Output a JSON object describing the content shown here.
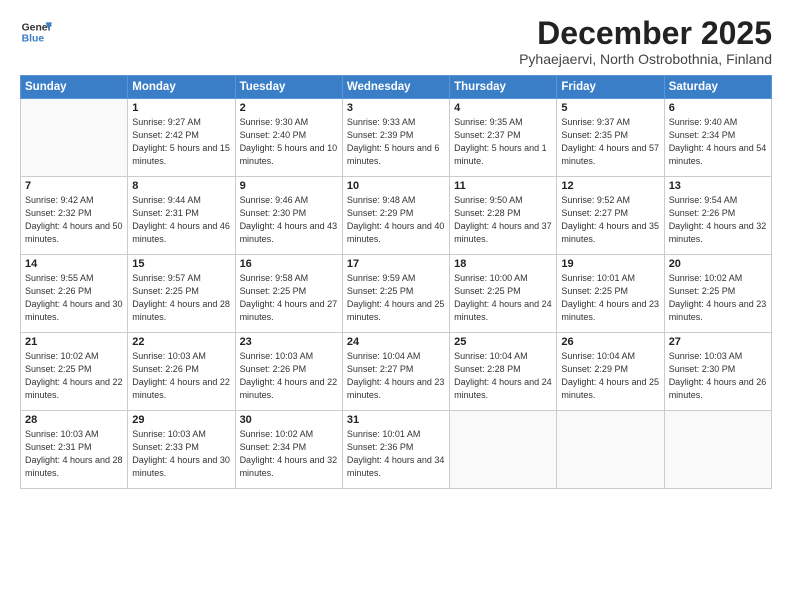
{
  "header": {
    "logo_line1": "General",
    "logo_line2": "Blue",
    "month": "December 2025",
    "location": "Pyhaejaervi, North Ostrobothnia, Finland"
  },
  "days_of_week": [
    "Sunday",
    "Monday",
    "Tuesday",
    "Wednesday",
    "Thursday",
    "Friday",
    "Saturday"
  ],
  "weeks": [
    [
      {
        "day": "",
        "info": ""
      },
      {
        "day": "1",
        "info": "Sunrise: 9:27 AM\nSunset: 2:42 PM\nDaylight: 5 hours\nand 15 minutes."
      },
      {
        "day": "2",
        "info": "Sunrise: 9:30 AM\nSunset: 2:40 PM\nDaylight: 5 hours\nand 10 minutes."
      },
      {
        "day": "3",
        "info": "Sunrise: 9:33 AM\nSunset: 2:39 PM\nDaylight: 5 hours\nand 6 minutes."
      },
      {
        "day": "4",
        "info": "Sunrise: 9:35 AM\nSunset: 2:37 PM\nDaylight: 5 hours\nand 1 minute."
      },
      {
        "day": "5",
        "info": "Sunrise: 9:37 AM\nSunset: 2:35 PM\nDaylight: 4 hours\nand 57 minutes."
      },
      {
        "day": "6",
        "info": "Sunrise: 9:40 AM\nSunset: 2:34 PM\nDaylight: 4 hours\nand 54 minutes."
      }
    ],
    [
      {
        "day": "7",
        "info": "Sunrise: 9:42 AM\nSunset: 2:32 PM\nDaylight: 4 hours\nand 50 minutes."
      },
      {
        "day": "8",
        "info": "Sunrise: 9:44 AM\nSunset: 2:31 PM\nDaylight: 4 hours\nand 46 minutes."
      },
      {
        "day": "9",
        "info": "Sunrise: 9:46 AM\nSunset: 2:30 PM\nDaylight: 4 hours\nand 43 minutes."
      },
      {
        "day": "10",
        "info": "Sunrise: 9:48 AM\nSunset: 2:29 PM\nDaylight: 4 hours\nand 40 minutes."
      },
      {
        "day": "11",
        "info": "Sunrise: 9:50 AM\nSunset: 2:28 PM\nDaylight: 4 hours\nand 37 minutes."
      },
      {
        "day": "12",
        "info": "Sunrise: 9:52 AM\nSunset: 2:27 PM\nDaylight: 4 hours\nand 35 minutes."
      },
      {
        "day": "13",
        "info": "Sunrise: 9:54 AM\nSunset: 2:26 PM\nDaylight: 4 hours\nand 32 minutes."
      }
    ],
    [
      {
        "day": "14",
        "info": "Sunrise: 9:55 AM\nSunset: 2:26 PM\nDaylight: 4 hours\nand 30 minutes."
      },
      {
        "day": "15",
        "info": "Sunrise: 9:57 AM\nSunset: 2:25 PM\nDaylight: 4 hours\nand 28 minutes."
      },
      {
        "day": "16",
        "info": "Sunrise: 9:58 AM\nSunset: 2:25 PM\nDaylight: 4 hours\nand 27 minutes."
      },
      {
        "day": "17",
        "info": "Sunrise: 9:59 AM\nSunset: 2:25 PM\nDaylight: 4 hours\nand 25 minutes."
      },
      {
        "day": "18",
        "info": "Sunrise: 10:00 AM\nSunset: 2:25 PM\nDaylight: 4 hours\nand 24 minutes."
      },
      {
        "day": "19",
        "info": "Sunrise: 10:01 AM\nSunset: 2:25 PM\nDaylight: 4 hours\nand 23 minutes."
      },
      {
        "day": "20",
        "info": "Sunrise: 10:02 AM\nSunset: 2:25 PM\nDaylight: 4 hours\nand 23 minutes."
      }
    ],
    [
      {
        "day": "21",
        "info": "Sunrise: 10:02 AM\nSunset: 2:25 PM\nDaylight: 4 hours\nand 22 minutes."
      },
      {
        "day": "22",
        "info": "Sunrise: 10:03 AM\nSunset: 2:26 PM\nDaylight: 4 hours\nand 22 minutes."
      },
      {
        "day": "23",
        "info": "Sunrise: 10:03 AM\nSunset: 2:26 PM\nDaylight: 4 hours\nand 22 minutes."
      },
      {
        "day": "24",
        "info": "Sunrise: 10:04 AM\nSunset: 2:27 PM\nDaylight: 4 hours\nand 23 minutes."
      },
      {
        "day": "25",
        "info": "Sunrise: 10:04 AM\nSunset: 2:28 PM\nDaylight: 4 hours\nand 24 minutes."
      },
      {
        "day": "26",
        "info": "Sunrise: 10:04 AM\nSunset: 2:29 PM\nDaylight: 4 hours\nand 25 minutes."
      },
      {
        "day": "27",
        "info": "Sunrise: 10:03 AM\nSunset: 2:30 PM\nDaylight: 4 hours\nand 26 minutes."
      }
    ],
    [
      {
        "day": "28",
        "info": "Sunrise: 10:03 AM\nSunset: 2:31 PM\nDaylight: 4 hours\nand 28 minutes."
      },
      {
        "day": "29",
        "info": "Sunrise: 10:03 AM\nSunset: 2:33 PM\nDaylight: 4 hours\nand 30 minutes."
      },
      {
        "day": "30",
        "info": "Sunrise: 10:02 AM\nSunset: 2:34 PM\nDaylight: 4 hours\nand 32 minutes."
      },
      {
        "day": "31",
        "info": "Sunrise: 10:01 AM\nSunset: 2:36 PM\nDaylight: 4 hours\nand 34 minutes."
      },
      {
        "day": "",
        "info": ""
      },
      {
        "day": "",
        "info": ""
      },
      {
        "day": "",
        "info": ""
      }
    ]
  ]
}
